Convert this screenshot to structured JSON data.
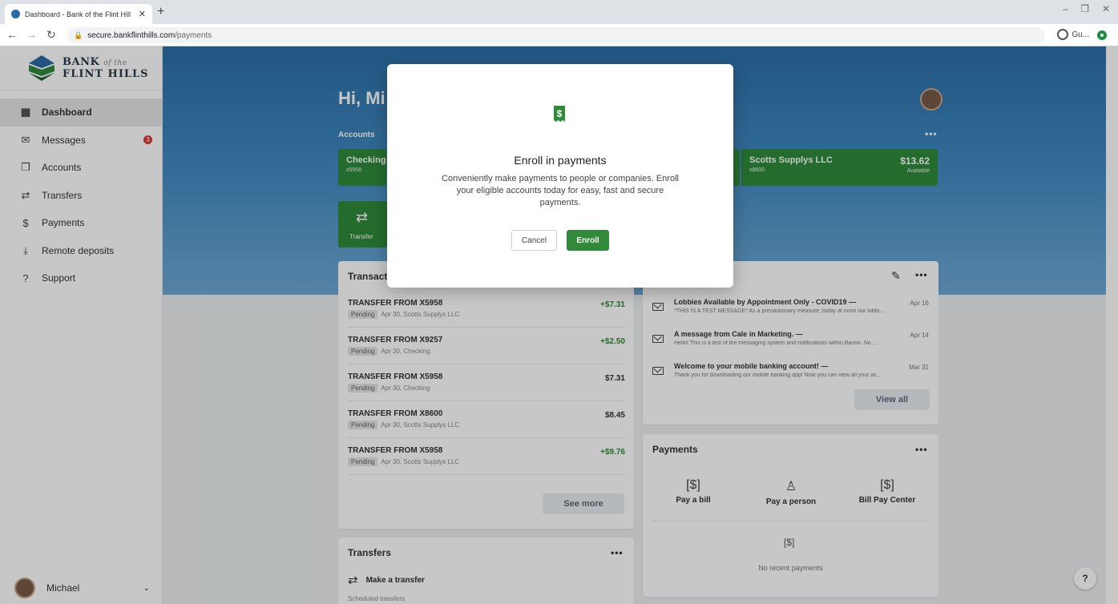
{
  "browser": {
    "tab_title": "Dashboard - Bank of the Flint Hill",
    "url_host": "secure.bankflinthills.com",
    "url_path": "/payments",
    "profile_label": "Gu..."
  },
  "brand": {
    "line1": "BANK",
    "line1_small": "of the",
    "line2": "FLINT HILLS"
  },
  "nav": [
    {
      "label": "Dashboard",
      "icon": "dashboard-icon"
    },
    {
      "label": "Messages",
      "icon": "envelope-icon",
      "badge": "3"
    },
    {
      "label": "Accounts",
      "icon": "accounts-icon"
    },
    {
      "label": "Transfers",
      "icon": "transfer-icon"
    },
    {
      "label": "Payments",
      "icon": "payment-icon"
    },
    {
      "label": "Remote deposits",
      "icon": "deposit-icon"
    },
    {
      "label": "Support",
      "icon": "help-icon"
    }
  ],
  "user": {
    "name": "Michael"
  },
  "greeting": "Hi, Mi",
  "accounts_label": "Accounts",
  "accounts": [
    {
      "name": "Checking",
      "number": "x5958"
    },
    {
      "name": "Scotts Supplys LLC",
      "number": "x8600",
      "balance": "$13.62",
      "available": "Available"
    }
  ],
  "transfer_tile": "Transfer",
  "transactions": {
    "title": "Transacti",
    "pending": "Pending",
    "items": [
      {
        "desc": "TRANSFER FROM X5958",
        "meta": "Apr 30, Scotts Supplys LLC",
        "amount": "+$7.31"
      },
      {
        "desc": "TRANSFER FROM X9257",
        "meta": "Apr 30, Checking",
        "amount": "+$2.50"
      },
      {
        "desc": "TRANSFER FROM X5958",
        "meta": "Apr 30, Checking",
        "amount": "$7.31"
      },
      {
        "desc": "TRANSFER FROM X8600",
        "meta": "Apr 30, Scotts Supplys LLC",
        "amount": "$8.45"
      },
      {
        "desc": "TRANSFER FROM X5958",
        "meta": "Apr 30, Scotts Supplys LLC",
        "amount": "+$9.76"
      }
    ],
    "see_more": "See more"
  },
  "messages": {
    "items": [
      {
        "subject": "Lobbies Available by Appointment Only - COVID19 —",
        "preview": "*THIS IS A TEST MESSAGE* As a precautionary measure, today at noon our lobbi...",
        "date": "Apr 16"
      },
      {
        "subject": "A message from Cale in Marketing. —",
        "preview": "Hello! This is a test of the messaging system and notifications within Banno. No ...",
        "date": "Apr 14"
      },
      {
        "subject": "Welcome to your mobile banking account! —",
        "preview": "Thank you for downloading our mobile banking app! Now you can view all your ac...",
        "date": "Mar 31"
      }
    ],
    "view_all": "View all"
  },
  "payments": {
    "title": "Payments",
    "options": [
      "Pay a bill",
      "Pay a person",
      "Bill Pay Center"
    ],
    "empty": "No recent payments"
  },
  "transfers": {
    "title": "Transfers",
    "make": "Make a transfer",
    "scheduled": "Scheduled transfers"
  },
  "dots": "•••",
  "help": "?",
  "modal": {
    "title": "Enroll in payments",
    "body": "Conveniently make payments to people or companies. Enroll your eligible accounts today for easy, fast and secure payments.",
    "cancel": "Cancel",
    "enroll": "Enroll",
    "icon_glyph": "$"
  },
  "colors": {
    "accent_green": "#2f8b3a",
    "hero_blue": "#3e88c0",
    "badge_red": "#d73a32"
  }
}
